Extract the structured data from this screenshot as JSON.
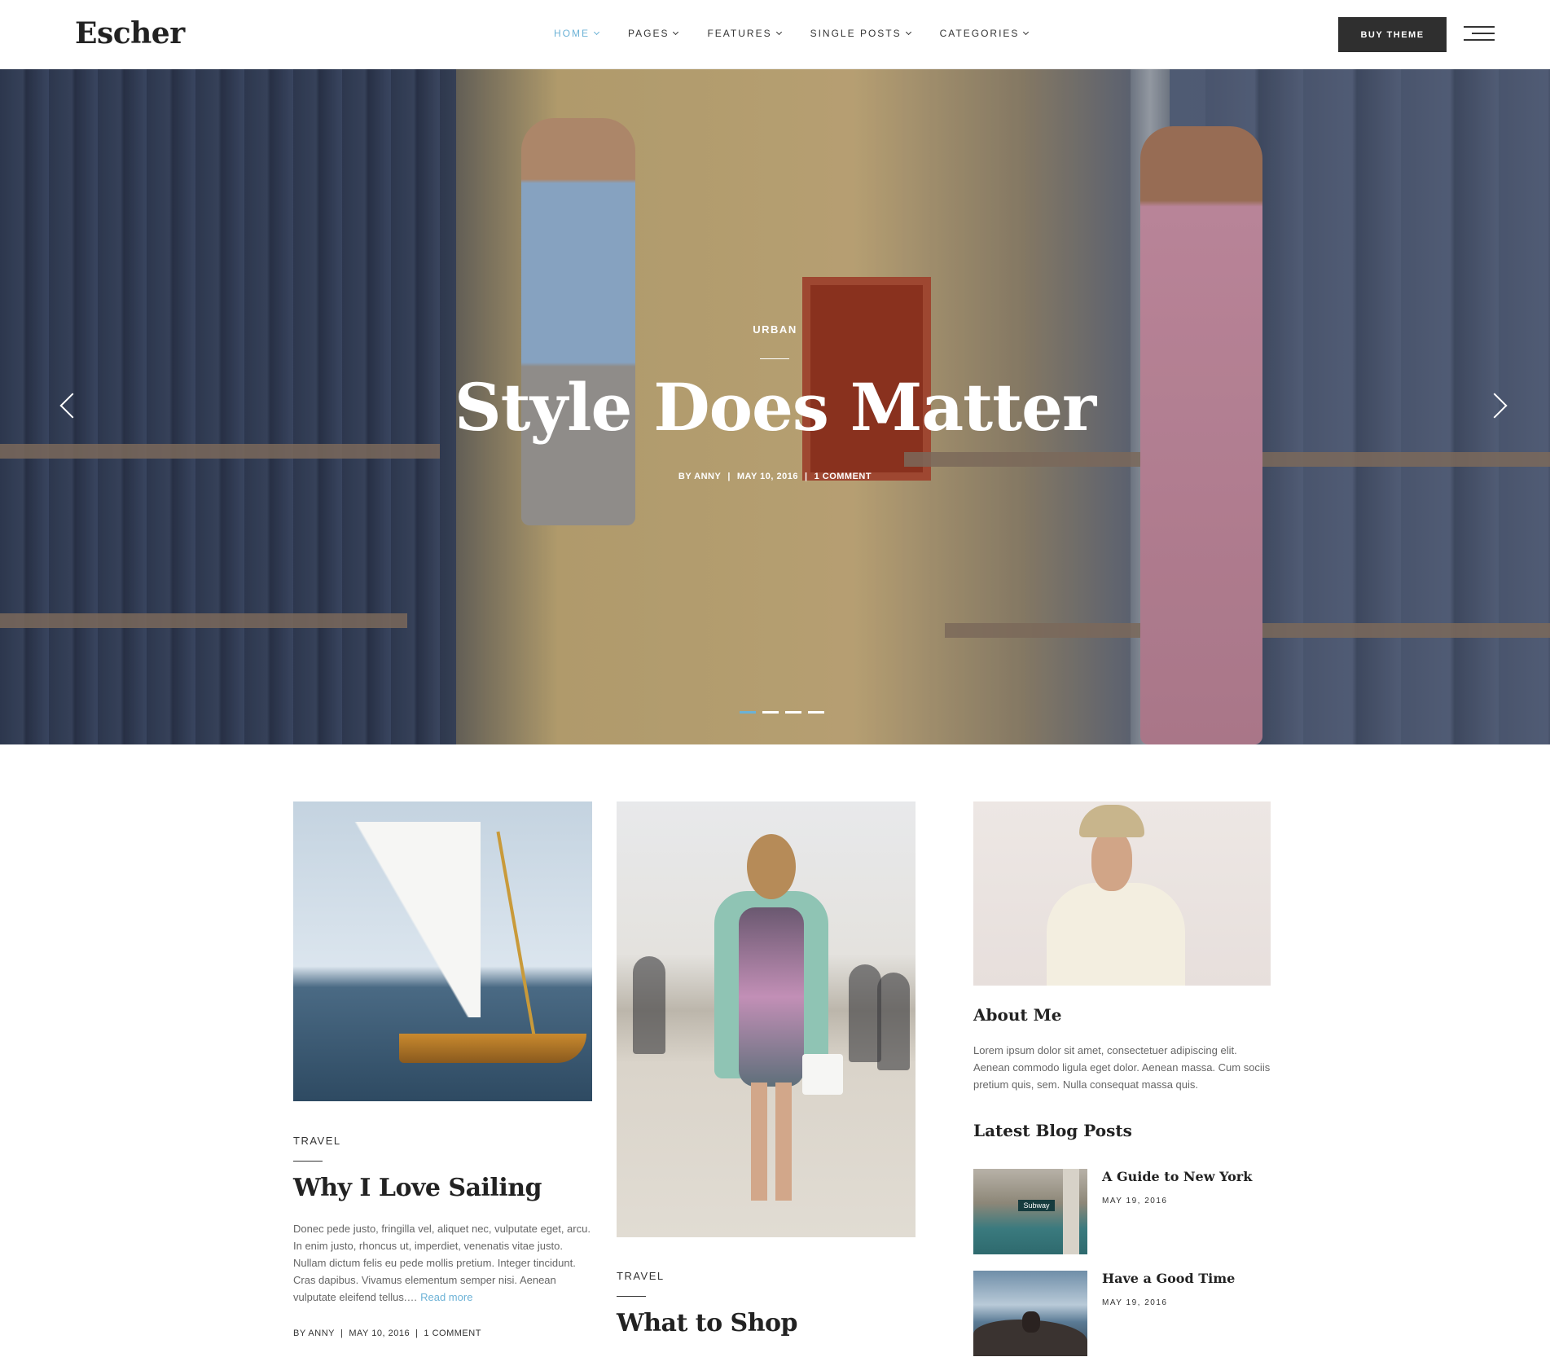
{
  "header": {
    "logo": "Escher",
    "nav": [
      {
        "label": "HOME",
        "active": true
      },
      {
        "label": "PAGES",
        "active": false
      },
      {
        "label": "FEATURES",
        "active": false
      },
      {
        "label": "SINGLE POSTS",
        "active": false
      },
      {
        "label": "CATEGORIES",
        "active": false
      }
    ],
    "buy_label": "BUY THEME",
    "menu_icon": "hamburger-icon"
  },
  "hero": {
    "category": "URBAN",
    "title": "Style Does Matter",
    "author": "BY ANNY",
    "date": "MAY 10, 2016",
    "comments": "1 COMMENT",
    "slides": 4,
    "active_slide": 1,
    "prev_icon": "chevron-left-icon",
    "next_icon": "chevron-right-icon"
  },
  "posts": [
    {
      "category": "TRAVEL",
      "title": "Why I Love Sailing",
      "excerpt": "Donec pede justo, fringilla vel, aliquet nec, vulputate eget, arcu. In enim justo, rhoncus ut, imperdiet, venenatis vitae justo. Nullam dictum felis eu pede mollis pretium. Integer tincidunt. Cras dapibus. Vivamus elementum semper nisi. Aenean vulputate eleifend tellus.…",
      "read_more": "Read more",
      "author": "BY ANNY",
      "date": "MAY 10, 2016",
      "comments": "1 COMMENT"
    },
    {
      "category": "TRAVEL",
      "title": "What to Shop"
    }
  ],
  "sidebar": {
    "about_title": "About Me",
    "about_text": "Lorem ipsum dolor sit amet, consectetuer adipiscing elit. Aenean commodo ligula eget dolor. Aenean massa. Cum sociis pretium quis, sem. Nulla consequat massa quis.",
    "latest_title": "Latest Blog Posts",
    "latest": [
      {
        "title": "A Guide to New York",
        "date": "MAY 19, 2016",
        "thumb_sign": "Subway"
      },
      {
        "title": "Have a Good Time",
        "date": "MAY 19, 2016"
      }
    ]
  },
  "colors": {
    "accent": "#6cb2d6",
    "dark_button": "#2f2f2f",
    "text": "#222222",
    "muted_text": "#666666"
  }
}
